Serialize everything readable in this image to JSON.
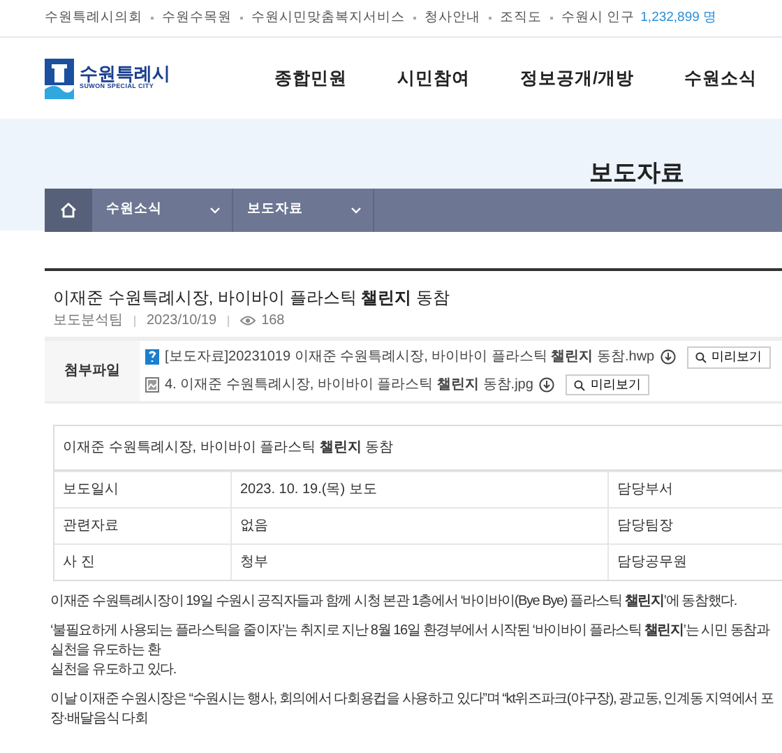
{
  "top_links": [
    "수원특례시의회",
    "수원수목원",
    "수원시민맞춤복지서비스",
    "청사안내",
    "조직도"
  ],
  "population": {
    "label": "수원시 인구",
    "value": "1,232,899 명"
  },
  "logo": {
    "name": "수원특례시",
    "tagline": "SUWON SPECIAL CITY"
  },
  "main_nav": [
    "종합민원",
    "시민참여",
    "정보공개/개방",
    "수원소식"
  ],
  "page_title": "보도자료",
  "breadcrumb": [
    "수원소식",
    "보도자료"
  ],
  "article": {
    "title": "이재준 수원특례시장, 바이바이 플라스틱 **챌린지** 동참",
    "author": "보도분석팀",
    "date": "2023/10/19",
    "views": "168"
  },
  "attachments": {
    "label": "첨부파일",
    "files": [
      {
        "kind": "hwp",
        "name": "[보도자료]20231019 이재준 수원특례시장, 바이바이 플라스틱 **챌린지** 동참.hwp",
        "preview": "미리보기"
      },
      {
        "kind": "image",
        "name": "4. 이재준 수원특례시장, 바이바이 플라스틱 **챌린지** 동참.jpg",
        "preview": "미리보기"
      }
    ]
  },
  "info_table": {
    "caption": "이재준 수원특례시장, 바이바이 플라스틱 **챌린지** 동참",
    "rows": [
      [
        "보도일시",
        "2023. 10. 19.(목) 보도",
        "담당부서"
      ],
      [
        "관련자료",
        "없음",
        "담당팀장"
      ],
      [
        "사 진",
        "청부",
        "담당공무원"
      ]
    ]
  },
  "body": [
    {
      "lines": [
        "이재준 수원특례시장이 19일 수원시 공직자들과 함께 시청 본관 1층에서 ‘바이바이(Bye Bye) 플라스틱 **챌린지**’에 동참했다."
      ]
    },
    {
      "lines": [
        "‘불필요하게 사용되는 플라스틱을 줄이자’는 취지로 지난 8월 16일 환경부에서 시작된 ‘바이바이 플라스틱 **챌린지**’는 시민 동참과 실천을 유도하는 환",
        "실천을 유도하고 있다."
      ]
    },
    {
      "lines": [
        "이날 이재준 수원시장은 “수원시는 행사, 회의에서 다회용컵을 사용하고 있다”며 “kt위즈파크(야구장), 광교동, 인계동 지역에서 포장·배달음식 다회"
      ]
    }
  ]
}
